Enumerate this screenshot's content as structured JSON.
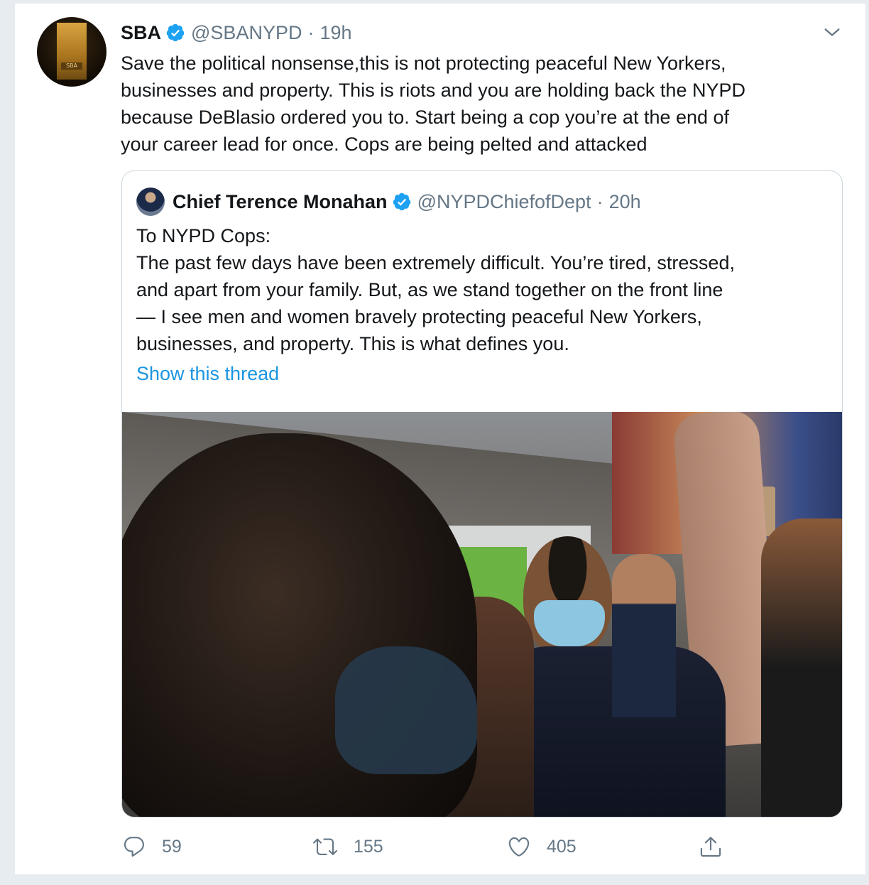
{
  "tweet": {
    "author_name": "SBA",
    "author_handle": "@SBANYPD",
    "separator": "·",
    "time": "19h",
    "text_lines": [
      "Save the political nonsense,this is not protecting peaceful New Yorkers,",
      "businesses and property. This is riots and you are holding back the NYPD",
      "because DeBlasio ordered you to. Start being a cop you’re at the end of",
      "your career lead for once. Cops are being pelted and attacked"
    ],
    "avatar_badge_text": "SBA"
  },
  "quoted": {
    "author_name": "Chief Terence Monahan",
    "author_handle": "@NYPDChiefofDept",
    "separator": "·",
    "time": "20h",
    "text_lines": [
      "To NYPD Cops:",
      "The past few days have been extremely difficult. You’re tired, stressed,",
      "and apart from your family. But, as we stand together on the front line",
      "— I see men and women bravely protecting peaceful New Yorkers,",
      "businesses, and property. This is what defines you."
    ],
    "show_thread": "Show this thread"
  },
  "actions": {
    "reply_count": "59",
    "retweet_count": "155",
    "like_count": "405"
  },
  "colors": {
    "verified": "#1da1f2",
    "link": "#1b95e0",
    "muted": "#657786"
  },
  "icons": [
    "verified-badge-icon",
    "chevron-down-icon",
    "reply-icon",
    "retweet-icon",
    "like-icon",
    "share-icon"
  ]
}
